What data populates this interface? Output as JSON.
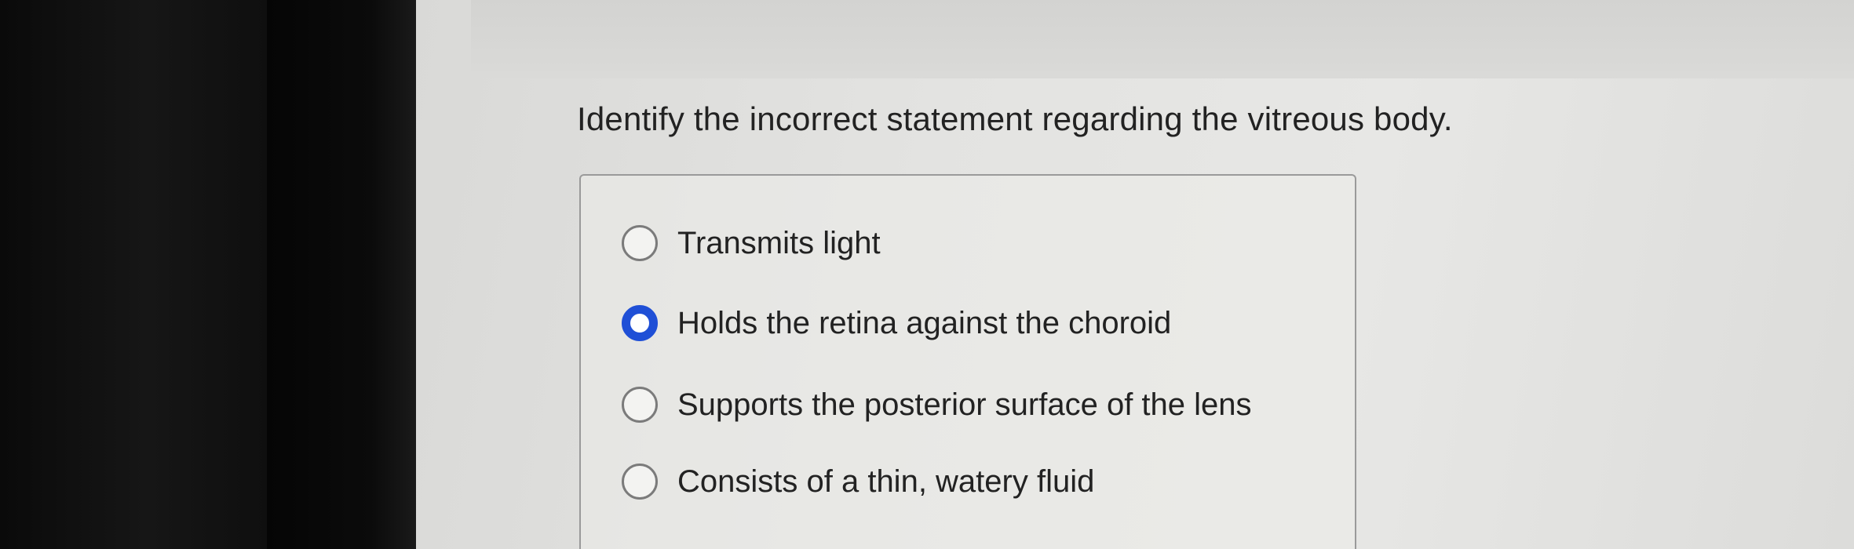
{
  "question": {
    "text": "Identify the incorrect statement regarding the vitreous body."
  },
  "options": [
    {
      "label": "Transmits light",
      "selected": false
    },
    {
      "label": "Holds the retina against the choroid",
      "selected": true
    },
    {
      "label": "Supports the posterior surface of the lens",
      "selected": false
    },
    {
      "label": "Consists of a thin, watery fluid",
      "selected": false
    }
  ],
  "colors": {
    "selected_radio": "#1f4fd6",
    "text": "#222222",
    "screen_background": "#e3e3e1",
    "bezel": "#0b0b0b"
  }
}
